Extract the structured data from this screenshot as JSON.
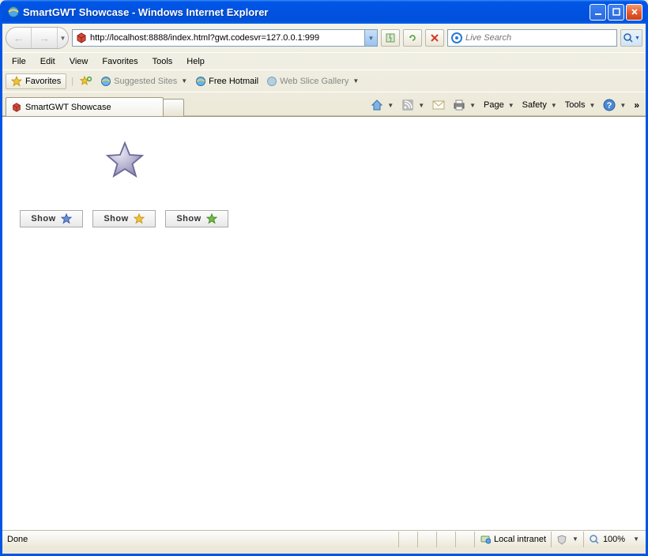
{
  "window": {
    "title": "SmartGWT Showcase - Windows Internet Explorer"
  },
  "nav": {
    "url_display": "http://localhost:8888/index.html?gwt.codesvr=127.0.0.1:999",
    "url_host": "localhost"
  },
  "search": {
    "placeholder": "Live Search"
  },
  "menu": {
    "file": "File",
    "edit": "Edit",
    "view": "View",
    "favorites": "Favorites",
    "tools": "Tools",
    "help": "Help"
  },
  "favbar": {
    "favorites": "Favorites",
    "suggested": "Suggested Sites",
    "hotmail": "Free Hotmail",
    "webslice": "Web Slice Gallery"
  },
  "tab": {
    "title": "SmartGWT Showcase"
  },
  "cmd": {
    "page": "Page",
    "safety": "Safety",
    "tools": "Tools"
  },
  "buttons": {
    "show": "Show"
  },
  "status": {
    "done": "Done",
    "zone": "Local intranet",
    "zoom": "100%"
  },
  "colors": {
    "star_blue": "#6e8fd7",
    "star_yellow": "#f2c43a",
    "star_green": "#6fbf44",
    "star_grey_fill": "#b4b2cf",
    "star_grey_stroke": "#6c6a98"
  }
}
